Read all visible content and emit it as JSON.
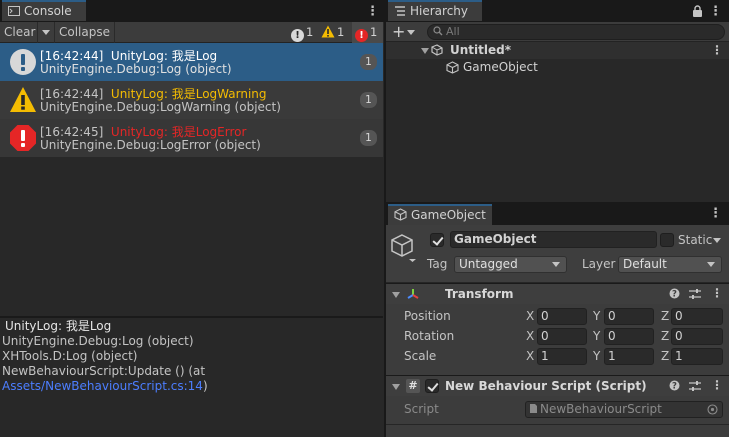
{
  "console": {
    "tab_label": "Console",
    "toolbar": {
      "clear": "Clear",
      "collapse": "Collapse",
      "info_count": "1",
      "warn_count": "1",
      "error_count": "1"
    },
    "entries": [
      {
        "time": "[16:42:44]",
        "message": "UnityLog: 我是Log",
        "source": "UnityEngine.Debug:Log (object)",
        "count": "1",
        "level": "info"
      },
      {
        "time": "[16:42:44]",
        "message": "UnityLog: 我是LogWarning",
        "source": "UnityEngine.Debug:LogWarning (object)",
        "count": "1",
        "level": "warning"
      },
      {
        "time": "[16:42:45]",
        "message": "UnityLog: 我是LogError",
        "source": "UnityEngine.Debug:LogError (object)",
        "count": "1",
        "level": "error"
      }
    ],
    "detail": {
      "line1": "UnityLog: 我是Log",
      "line2": "UnityEngine.Debug:Log (object)",
      "line3": "XHTools.D:Log (object)",
      "line4": "NewBehaviourScript:Update () (at",
      "link": "Assets/NewBehaviourScript.cs:14",
      "link_suffix": ")"
    }
  },
  "hierarchy": {
    "tab_label": "Hierarchy",
    "search_placeholder": "All",
    "scene_name": "Untitled*",
    "objects": [
      "GameObject"
    ]
  },
  "inspector": {
    "tab_label": "GameObject",
    "name": "GameObject",
    "static_label": "Static",
    "tag_label": "Tag",
    "tag_value": "Untagged",
    "layer_label": "Layer",
    "layer_value": "Default",
    "transform": {
      "title": "Transform",
      "rows": [
        {
          "label": "Position",
          "x": "0",
          "y": "0",
          "z": "0"
        },
        {
          "label": "Rotation",
          "x": "0",
          "y": "0",
          "z": "0"
        },
        {
          "label": "Scale",
          "x": "1",
          "y": "1",
          "z": "1"
        }
      ],
      "axis_x": "X",
      "axis_y": "Y",
      "axis_z": "Z"
    },
    "script": {
      "title": "New Behaviour Script (Script)",
      "field_label": "Script",
      "field_value": "NewBehaviourScript"
    }
  },
  "colors": {
    "selection": "#2c5d87",
    "warning": "#f4bc02",
    "error": "#e52626",
    "link": "#4c7eff"
  }
}
